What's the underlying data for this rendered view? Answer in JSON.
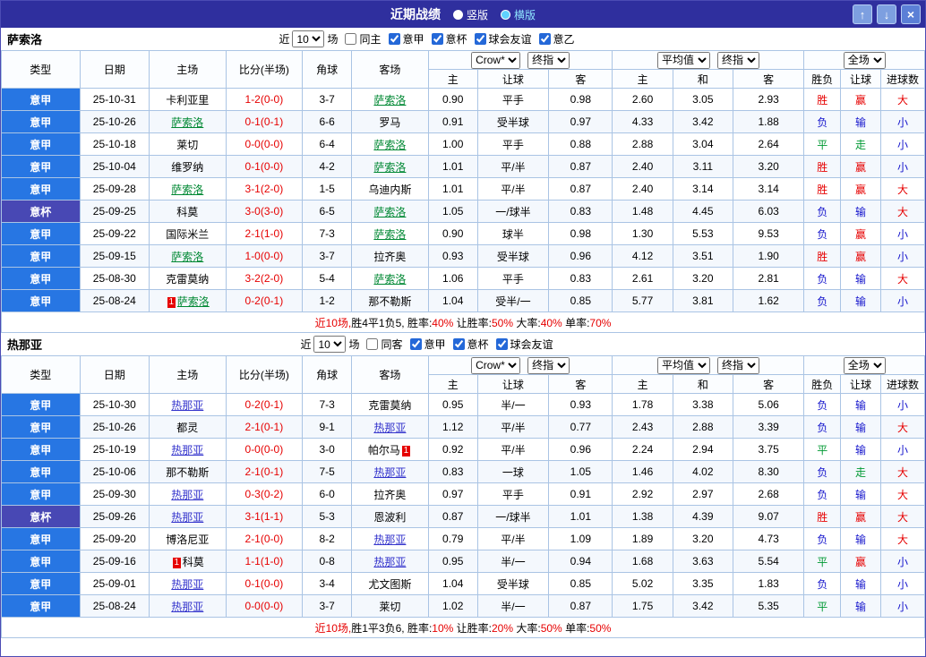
{
  "header": {
    "title": "近期战绩",
    "vertical": "竖版",
    "horizontal": "横版",
    "up": "↑",
    "down": "↓",
    "close": "×"
  },
  "labels": {
    "near": "近",
    "matches": "场"
  },
  "table_headers": {
    "type": "类型",
    "date": "日期",
    "home": "主场",
    "score": "比分(半场)",
    "corner": "角球",
    "away": "客场",
    "odds_source": "Crow*",
    "final_label": "终指",
    "avg_label": "平均值",
    "avg_final_label": "终指",
    "full_label": "全场",
    "sub": [
      "主",
      "让球",
      "客",
      "主",
      "和",
      "客",
      "胜负",
      "让球",
      "进球数"
    ]
  },
  "colors": {
    "win": "#e60000",
    "draw": "#009933",
    "lose": "#1414cc",
    "big": "#e60000",
    "small": "#1414cc",
    "score": "#e60000",
    "league_bg": "#2776e3",
    "cup_bg": "#4848b4"
  },
  "sections": [
    {
      "team": "萨索洛",
      "team_color": "#008833",
      "filter": {
        "count": "10",
        "checkboxes": [
          {
            "label": "同主",
            "checked": false
          },
          {
            "label": "意甲",
            "checked": true
          },
          {
            "label": "意杯",
            "checked": true
          },
          {
            "label": "球会友谊",
            "checked": true
          },
          {
            "label": "意乙",
            "checked": true
          }
        ]
      },
      "rows": [
        {
          "league": "意甲",
          "date": "25-10-31",
          "home": {
            "name": "卡利亚里"
          },
          "score": "1-2(0-0)",
          "corner": "3-7",
          "away": {
            "name": "萨索洛",
            "focus": true
          },
          "o1": "0.90",
          "line": "平手",
          "o2": "0.98",
          "a1": "2.60",
          "a2": "3.05",
          "a3": "2.93",
          "res": "胜",
          "han": "赢",
          "goal": "大"
        },
        {
          "league": "意甲",
          "date": "25-10-26",
          "home": {
            "name": "萨索洛",
            "focus": true
          },
          "score": "0-1(0-1)",
          "corner": "6-6",
          "away": {
            "name": "罗马"
          },
          "o1": "0.91",
          "line": "受半球",
          "o2": "0.97",
          "a1": "4.33",
          "a2": "3.42",
          "a3": "1.88",
          "res": "负",
          "han": "输",
          "goal": "小"
        },
        {
          "league": "意甲",
          "date": "25-10-18",
          "home": {
            "name": "莱切"
          },
          "score": "0-0(0-0)",
          "corner": "6-4",
          "away": {
            "name": "萨索洛",
            "focus": true
          },
          "o1": "1.00",
          "line": "平手",
          "o2": "0.88",
          "a1": "2.88",
          "a2": "3.04",
          "a3": "2.64",
          "res": "平",
          "han": "走",
          "goal": "小"
        },
        {
          "league": "意甲",
          "date": "25-10-04",
          "home": {
            "name": "维罗纳"
          },
          "score": "0-1(0-0)",
          "corner": "4-2",
          "away": {
            "name": "萨索洛",
            "focus": true
          },
          "o1": "1.01",
          "line": "平/半",
          "o2": "0.87",
          "a1": "2.40",
          "a2": "3.11",
          "a3": "3.20",
          "res": "胜",
          "han": "赢",
          "goal": "小"
        },
        {
          "league": "意甲",
          "date": "25-09-28",
          "home": {
            "name": "萨索洛",
            "focus": true
          },
          "score": "3-1(2-0)",
          "corner": "1-5",
          "away": {
            "name": "乌迪内斯"
          },
          "o1": "1.01",
          "line": "平/半",
          "o2": "0.87",
          "a1": "2.40",
          "a2": "3.14",
          "a3": "3.14",
          "res": "胜",
          "han": "赢",
          "goal": "大"
        },
        {
          "league": "意杯",
          "cup": true,
          "date": "25-09-25",
          "home": {
            "name": "科莫"
          },
          "score": "3-0(3-0)",
          "corner": "6-5",
          "away": {
            "name": "萨索洛",
            "focus": true
          },
          "o1": "1.05",
          "line": "一/球半",
          "o2": "0.83",
          "a1": "1.48",
          "a2": "4.45",
          "a3": "6.03",
          "res": "负",
          "han": "输",
          "goal": "大"
        },
        {
          "league": "意甲",
          "date": "25-09-22",
          "home": {
            "name": "国际米兰"
          },
          "score": "2-1(1-0)",
          "corner": "7-3",
          "away": {
            "name": "萨索洛",
            "focus": true
          },
          "o1": "0.90",
          "line": "球半",
          "o2": "0.98",
          "a1": "1.30",
          "a2": "5.53",
          "a3": "9.53",
          "res": "负",
          "han": "赢",
          "goal": "小"
        },
        {
          "league": "意甲",
          "date": "25-09-15",
          "home": {
            "name": "萨索洛",
            "focus": true
          },
          "score": "1-0(0-0)",
          "corner": "3-7",
          "away": {
            "name": "拉齐奥"
          },
          "o1": "0.93",
          "line": "受半球",
          "o2": "0.96",
          "a1": "4.12",
          "a2": "3.51",
          "a3": "1.90",
          "res": "胜",
          "han": "赢",
          "goal": "小"
        },
        {
          "league": "意甲",
          "date": "25-08-30",
          "home": {
            "name": "克雷莫纳"
          },
          "score": "3-2(2-0)",
          "corner": "5-4",
          "away": {
            "name": "萨索洛",
            "focus": true
          },
          "o1": "1.06",
          "line": "平手",
          "o2": "0.83",
          "a1": "2.61",
          "a2": "3.20",
          "a3": "2.81",
          "res": "负",
          "han": "输",
          "goal": "大"
        },
        {
          "league": "意甲",
          "date": "25-08-24",
          "home": {
            "name": "萨索洛",
            "focus": true,
            "card": "before"
          },
          "score": "0-2(0-1)",
          "corner": "1-2",
          "away": {
            "name": "那不勒斯"
          },
          "o1": "1.04",
          "line": "受半/一",
          "o2": "0.85",
          "a1": "5.77",
          "a2": "3.81",
          "a3": "1.62",
          "res": "负",
          "han": "输",
          "goal": "小"
        }
      ],
      "summary": [
        {
          "t": "近10场,",
          "c": "#e60000"
        },
        {
          "t": "胜4平1负5, ",
          "c": "#000000"
        },
        {
          "t": "胜率:",
          "c": "#000000"
        },
        {
          "t": "40%",
          "c": "#e60000"
        },
        {
          "t": " 让胜率:",
          "c": "#000000"
        },
        {
          "t": "50%",
          "c": "#e60000"
        },
        {
          "t": " 大率:",
          "c": "#000000"
        },
        {
          "t": "40%",
          "c": "#e60000"
        },
        {
          "t": " 单率:",
          "c": "#000000"
        },
        {
          "t": "70%",
          "c": "#e60000"
        }
      ]
    },
    {
      "team": "热那亚",
      "team_color": "#3333cc",
      "filter": {
        "count": "10",
        "checkboxes": [
          {
            "label": "同客",
            "checked": false
          },
          {
            "label": "意甲",
            "checked": true
          },
          {
            "label": "意杯",
            "checked": true
          },
          {
            "label": "球会友谊",
            "checked": true
          }
        ]
      },
      "rows": [
        {
          "league": "意甲",
          "date": "25-10-30",
          "home": {
            "name": "热那亚",
            "focus": true
          },
          "score": "0-2(0-1)",
          "corner": "7-3",
          "away": {
            "name": "克雷莫纳"
          },
          "o1": "0.95",
          "line": "半/一",
          "o2": "0.93",
          "a1": "1.78",
          "a2": "3.38",
          "a3": "5.06",
          "res": "负",
          "han": "输",
          "goal": "小"
        },
        {
          "league": "意甲",
          "date": "25-10-26",
          "home": {
            "name": "都灵"
          },
          "score": "2-1(0-1)",
          "corner": "9-1",
          "away": {
            "name": "热那亚",
            "focus": true
          },
          "o1": "1.12",
          "line": "平/半",
          "o2": "0.77",
          "a1": "2.43",
          "a2": "2.88",
          "a3": "3.39",
          "res": "负",
          "han": "输",
          "goal": "大"
        },
        {
          "league": "意甲",
          "date": "25-10-19",
          "home": {
            "name": "热那亚",
            "focus": true
          },
          "score": "0-0(0-0)",
          "corner": "3-0",
          "away": {
            "name": "帕尔马",
            "card": "after"
          },
          "o1": "0.92",
          "line": "平/半",
          "o2": "0.96",
          "a1": "2.24",
          "a2": "2.94",
          "a3": "3.75",
          "res": "平",
          "han": "输",
          "goal": "小"
        },
        {
          "league": "意甲",
          "date": "25-10-06",
          "home": {
            "name": "那不勒斯"
          },
          "score": "2-1(0-1)",
          "corner": "7-5",
          "away": {
            "name": "热那亚",
            "focus": true
          },
          "o1": "0.83",
          "line": "一球",
          "o2": "1.05",
          "a1": "1.46",
          "a2": "4.02",
          "a3": "8.30",
          "res": "负",
          "han": "走",
          "goal": "大"
        },
        {
          "league": "意甲",
          "date": "25-09-30",
          "home": {
            "name": "热那亚",
            "focus": true
          },
          "score": "0-3(0-2)",
          "corner": "6-0",
          "away": {
            "name": "拉齐奥"
          },
          "o1": "0.97",
          "line": "平手",
          "o2": "0.91",
          "a1": "2.92",
          "a2": "2.97",
          "a3": "2.68",
          "res": "负",
          "han": "输",
          "goal": "大"
        },
        {
          "league": "意杯",
          "cup": true,
          "date": "25-09-26",
          "home": {
            "name": "热那亚",
            "focus": true
          },
          "score": "3-1(1-1)",
          "corner": "5-3",
          "away": {
            "name": "恩波利"
          },
          "o1": "0.87",
          "line": "一/球半",
          "o2": "1.01",
          "a1": "1.38",
          "a2": "4.39",
          "a3": "9.07",
          "res": "胜",
          "han": "赢",
          "goal": "大"
        },
        {
          "league": "意甲",
          "date": "25-09-20",
          "home": {
            "name": "博洛尼亚"
          },
          "score": "2-1(0-0)",
          "corner": "8-2",
          "away": {
            "name": "热那亚",
            "focus": true
          },
          "o1": "0.79",
          "line": "平/半",
          "o2": "1.09",
          "a1": "1.89",
          "a2": "3.20",
          "a3": "4.73",
          "res": "负",
          "han": "输",
          "goal": "大"
        },
        {
          "league": "意甲",
          "date": "25-09-16",
          "home": {
            "name": "科莫",
            "card": "before"
          },
          "score": "1-1(1-0)",
          "corner": "0-8",
          "away": {
            "name": "热那亚",
            "focus": true
          },
          "o1": "0.95",
          "line": "半/一",
          "o2": "0.94",
          "a1": "1.68",
          "a2": "3.63",
          "a3": "5.54",
          "res": "平",
          "han": "赢",
          "goal": "小"
        },
        {
          "league": "意甲",
          "date": "25-09-01",
          "home": {
            "name": "热那亚",
            "focus": true
          },
          "score": "0-1(0-0)",
          "corner": "3-4",
          "away": {
            "name": "尤文图斯"
          },
          "o1": "1.04",
          "line": "受半球",
          "o2": "0.85",
          "a1": "5.02",
          "a2": "3.35",
          "a3": "1.83",
          "res": "负",
          "han": "输",
          "goal": "小"
        },
        {
          "league": "意甲",
          "date": "25-08-24",
          "home": {
            "name": "热那亚",
            "focus": true
          },
          "score": "0-0(0-0)",
          "corner": "3-7",
          "away": {
            "name": "莱切"
          },
          "o1": "1.02",
          "line": "半/一",
          "o2": "0.87",
          "a1": "1.75",
          "a2": "3.42",
          "a3": "5.35",
          "res": "平",
          "han": "输",
          "goal": "小"
        }
      ],
      "summary": [
        {
          "t": "近10场,",
          "c": "#e60000"
        },
        {
          "t": "胜1平3负6, ",
          "c": "#000000"
        },
        {
          "t": "胜率:",
          "c": "#000000"
        },
        {
          "t": "10%",
          "c": "#e60000"
        },
        {
          "t": " 让胜率:",
          "c": "#000000"
        },
        {
          "t": "20%",
          "c": "#e60000"
        },
        {
          "t": " 大率:",
          "c": "#000000"
        },
        {
          "t": "50%",
          "c": "#e60000"
        },
        {
          "t": " 单率:",
          "c": "#000000"
        },
        {
          "t": "50%",
          "c": "#e60000"
        }
      ]
    }
  ]
}
